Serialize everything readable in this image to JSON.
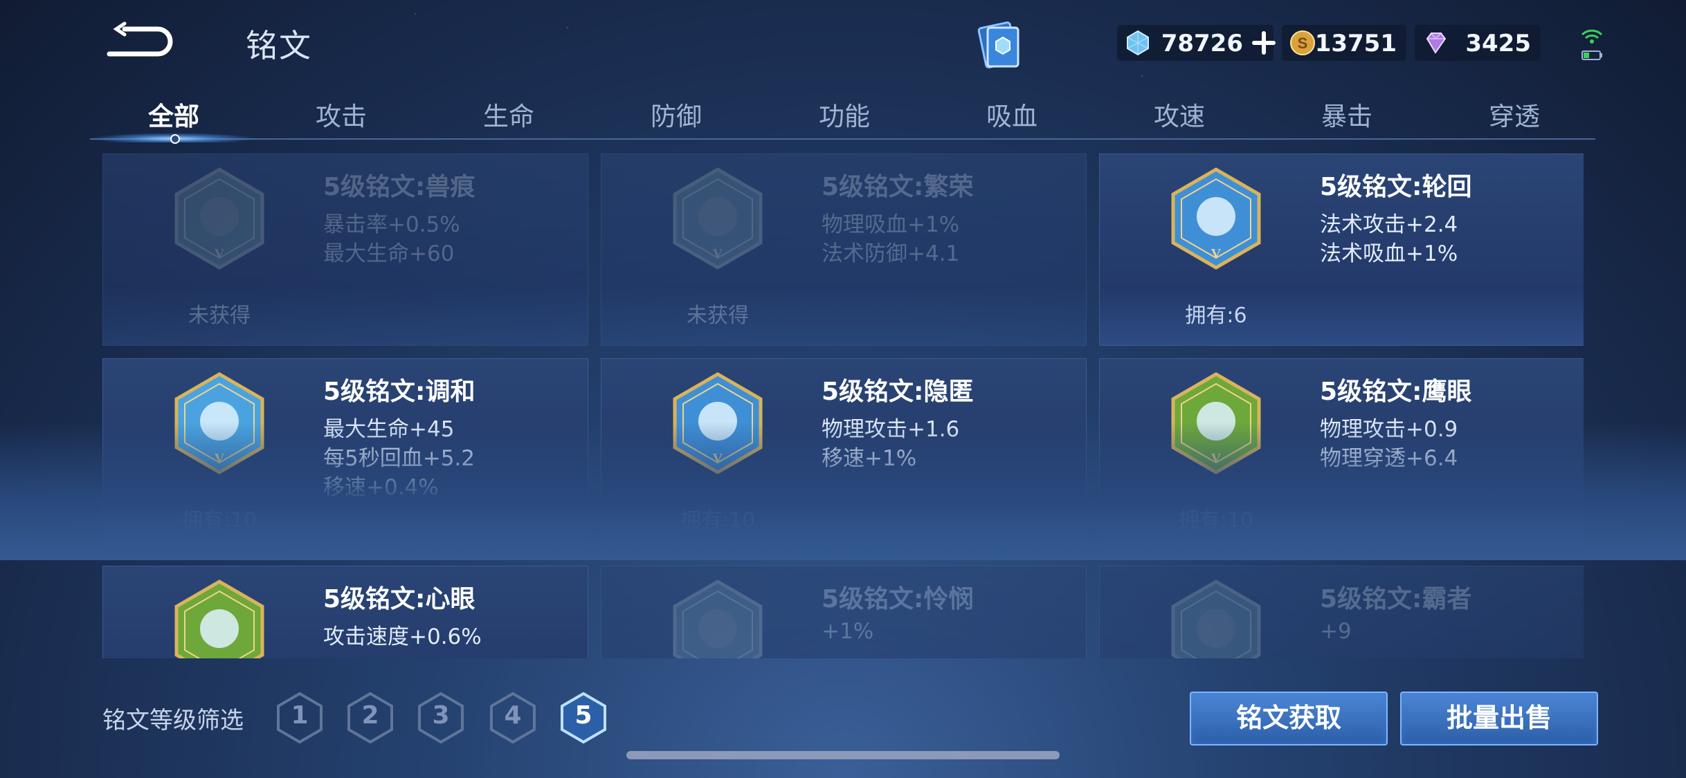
{
  "header": {
    "title": "铭文",
    "currencies": [
      {
        "name": "gem",
        "value": "78726"
      },
      {
        "name": "coin",
        "value": "13751"
      },
      {
        "name": "diamond",
        "value": "3425"
      }
    ]
  },
  "tabs": [
    "全部",
    "攻击",
    "生命",
    "防御",
    "功能",
    "吸血",
    "攻速",
    "暴击",
    "穿透"
  ],
  "active_tab": "全部",
  "cards": [
    {
      "name": "5级铭文:兽痕",
      "stats": [
        "暴击率+0.5%",
        "最大生命+60"
      ],
      "owned": "未获得",
      "obtained": false,
      "color": "#4a6a8a"
    },
    {
      "name": "5级铭文:繁荣",
      "stats": [
        "物理吸血+1%",
        "法术防御+4.1"
      ],
      "owned": "未获得",
      "obtained": false,
      "color": "#4a6a8a"
    },
    {
      "name": "5级铭文:轮回",
      "stats": [
        "法术攻击+2.4",
        "法术吸血+1%"
      ],
      "owned": "拥有:6",
      "obtained": true,
      "color": "#3f8fd6"
    },
    {
      "name": "5级铭文:调和",
      "stats": [
        "最大生命+45",
        "每5秒回血+5.2",
        "移速+0.4%"
      ],
      "owned": "拥有:10",
      "obtained": true,
      "color": "#4aa3e0"
    },
    {
      "name": "5级铭文:隐匿",
      "stats": [
        "物理攻击+1.6",
        "移速+1%"
      ],
      "owned": "拥有:10",
      "obtained": true,
      "color": "#3f8fd6"
    },
    {
      "name": "5级铭文:鹰眼",
      "stats": [
        "物理攻击+0.9",
        "物理穿透+6.4"
      ],
      "owned": "拥有:10",
      "obtained": true,
      "color": "#6ea83a"
    },
    {
      "name": "5级铭文:心眼",
      "stats": [
        "攻击速度+0.6%"
      ],
      "owned": "",
      "obtained": true,
      "color": "#6ea83a"
    },
    {
      "name": "5级铭文:怜悯",
      "stats": [
        "+1%"
      ],
      "owned": "",
      "obtained": false,
      "color": "#4a6a8a"
    },
    {
      "name": "5级铭文:霸者",
      "stats": [
        "+9"
      ],
      "owned": "",
      "obtained": false,
      "color": "#4a6a8a"
    }
  ],
  "filter": {
    "label": "铭文等级筛选",
    "levels": [
      "1",
      "2",
      "3",
      "4",
      "5"
    ],
    "active_level": "5"
  },
  "buttons": {
    "obtain": "铭文获取",
    "sell": "批量出售"
  }
}
